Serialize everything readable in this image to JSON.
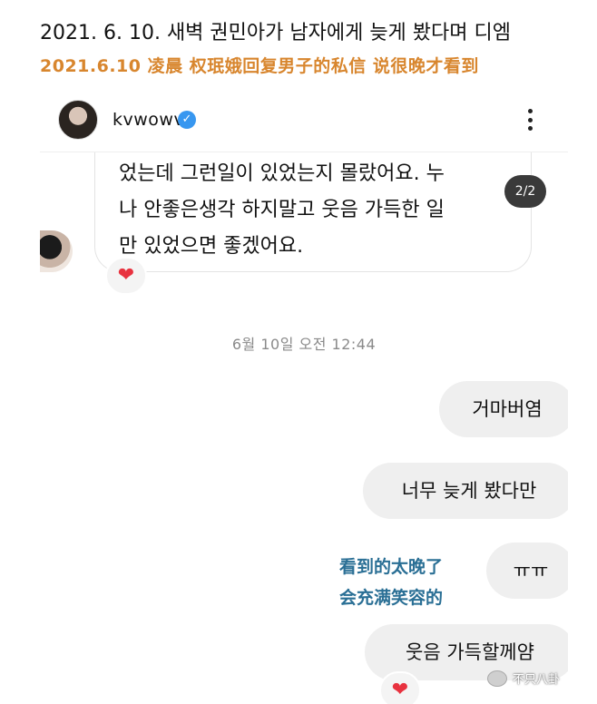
{
  "captions": {
    "korean": "2021. 6. 10. 새벽 권민아가 남자에게 늦게 봤다며 디엠",
    "chinese": "2021.6.10 凌晨 权珉娥回复男子的私信 说很晚才看到"
  },
  "header": {
    "username": "kvwowv",
    "verified_icon": "verified-badge-icon",
    "more_icon": "more-vertical-icon"
  },
  "received_message": {
    "lines": [
      "었는데 그런일이 있었는지 몰랐어요. 누",
      "나 안좋은생각 하지말고 웃음 가득한 일",
      "만 있었으면 좋겠어요."
    ],
    "page_indicator": "2/2",
    "reaction": "❤"
  },
  "timestamp": "6월 10일 오전 12:44",
  "sent_messages": [
    "거마버염",
    "너무 늦게 봤다만",
    "ㅠㅠ",
    "웃음 가득할께얌"
  ],
  "sent_reaction": "❤",
  "overlay_note": {
    "line1": "看到的太晚了",
    "line2": "会充满笑容的"
  },
  "watermark": {
    "text": "不只八卦",
    "icon": "wechat-icon"
  },
  "colors": {
    "chinese_caption": "#d8862e",
    "overlay_note": "#2a6f95",
    "verified": "#3897f0",
    "bubble": "#efefef"
  }
}
